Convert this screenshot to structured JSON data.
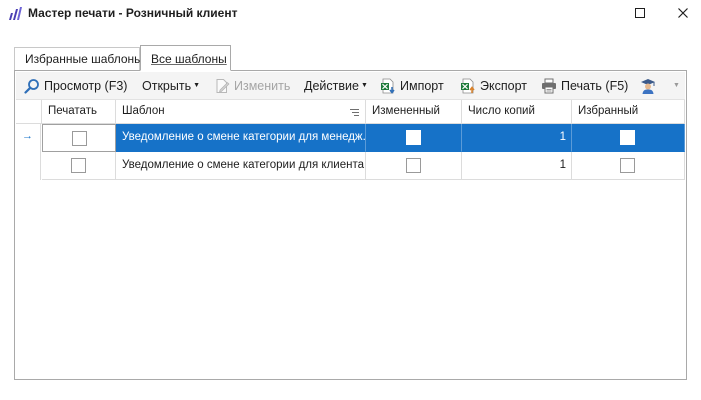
{
  "window": {
    "title": "Мастер печати - Розничный клиент"
  },
  "tabs": [
    {
      "label": "Избранные шаблоны",
      "active": false
    },
    {
      "label": "Все шаблоны",
      "active": true
    }
  ],
  "toolbar": {
    "view_label": "Просмотр (F3)",
    "open_label": "Открыть",
    "edit_label": "Изменить",
    "action_label": "Действие",
    "import_label": "Импорт",
    "export_label": "Экспорт",
    "print_label": "Печать (F5)"
  },
  "grid": {
    "columns": [
      "Печатать",
      "Шаблон",
      "Измененный",
      "Число копий",
      "Избранный"
    ],
    "rows": [
      {
        "print": false,
        "template": "Уведомление о смене категории для менедж...",
        "modified": false,
        "copies": "1",
        "favorite": false,
        "selected": true
      },
      {
        "print": false,
        "template": "Уведомление о смене категории для клиента",
        "modified": false,
        "copies": "1",
        "favorite": false,
        "selected": false
      }
    ]
  },
  "colors": {
    "selection": "#1672c8",
    "accent": "#4a3fb3"
  }
}
